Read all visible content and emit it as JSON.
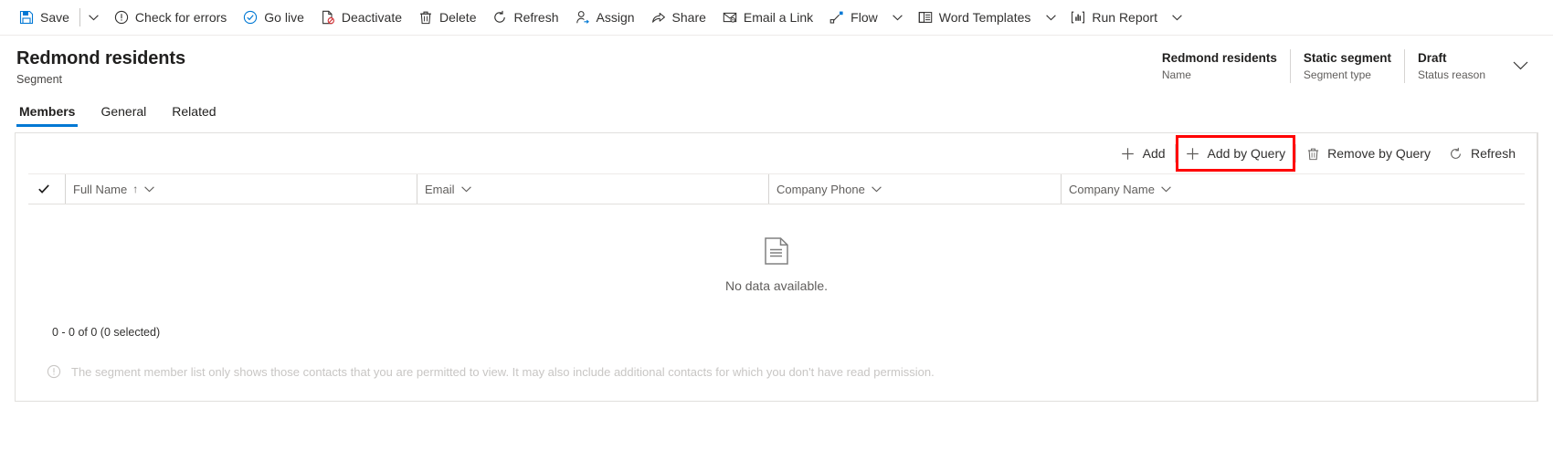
{
  "command_bar": {
    "items": [
      {
        "id": "save",
        "label": "Save",
        "icon": "save-icon",
        "has_split": true
      },
      {
        "id": "check-for-errors",
        "label": "Check for errors",
        "icon": "error-circle-icon",
        "has_split": false
      },
      {
        "id": "go-live",
        "label": "Go live",
        "icon": "check-circle-icon",
        "has_split": false
      },
      {
        "id": "deactivate",
        "label": "Deactivate",
        "icon": "deactivate-icon",
        "has_split": false
      },
      {
        "id": "delete",
        "label": "Delete",
        "icon": "trash-icon",
        "has_split": false
      },
      {
        "id": "refresh",
        "label": "Refresh",
        "icon": "refresh-icon",
        "has_split": false
      },
      {
        "id": "assign",
        "label": "Assign",
        "icon": "assign-person-icon",
        "has_split": false
      },
      {
        "id": "share",
        "label": "Share",
        "icon": "share-icon",
        "has_split": false
      },
      {
        "id": "email-a-link",
        "label": "Email a Link",
        "icon": "email-link-icon",
        "has_split": false
      },
      {
        "id": "flow",
        "label": "Flow",
        "icon": "flow-icon",
        "has_split": true
      },
      {
        "id": "word-templates",
        "label": "Word Templates",
        "icon": "word-template-icon",
        "has_split": true
      },
      {
        "id": "run-report",
        "label": "Run Report",
        "icon": "run-report-icon",
        "has_split": true
      }
    ]
  },
  "record_header": {
    "title": "Redmond residents",
    "subtitle": "Segment",
    "fields": [
      {
        "id": "name",
        "value": "Redmond residents",
        "caption": "Name"
      },
      {
        "id": "segment-type",
        "value": "Static segment",
        "caption": "Segment type"
      },
      {
        "id": "status-reason",
        "value": "Draft",
        "caption": "Status reason"
      }
    ]
  },
  "tabs": [
    {
      "id": "members",
      "label": "Members",
      "active": true
    },
    {
      "id": "general",
      "label": "General",
      "active": false
    },
    {
      "id": "related",
      "label": "Related",
      "active": false
    }
  ],
  "grid": {
    "command_bar": [
      {
        "id": "add",
        "label": "Add",
        "icon": "plus-icon",
        "highlighted": false
      },
      {
        "id": "add-by-query",
        "label": "Add by Query",
        "icon": "plus-icon",
        "highlighted": true
      },
      {
        "id": "remove-by-query",
        "label": "Remove by Query",
        "icon": "trash-icon",
        "highlighted": false
      },
      {
        "id": "refresh",
        "label": "Refresh",
        "icon": "refresh-icon",
        "highlighted": false
      }
    ],
    "columns": [
      {
        "id": "full-name",
        "label": "Full Name",
        "sorted": true,
        "sort_direction": "↑"
      },
      {
        "id": "email",
        "label": "Email",
        "sorted": false,
        "sort_direction": ""
      },
      {
        "id": "company-phone",
        "label": "Company Phone",
        "sorted": false,
        "sort_direction": ""
      },
      {
        "id": "company-name",
        "label": "Company Name",
        "sorted": false,
        "sort_direction": ""
      }
    ],
    "empty_state": {
      "icon": "document-icon",
      "text": "No data available."
    },
    "record_count": "0 - 0 of 0 (0 selected)",
    "note_icon": "info-icon",
    "note": "The segment member list only shows those contacts that you are permitted to view. It may also include additional contacts for which you don't have read permission."
  },
  "colors": {
    "accent": "#0078d4",
    "highlight_box": "#ff0000",
    "text_primary": "#201f1e",
    "text_secondary": "#605e5c",
    "border": "#e1dfdd"
  }
}
